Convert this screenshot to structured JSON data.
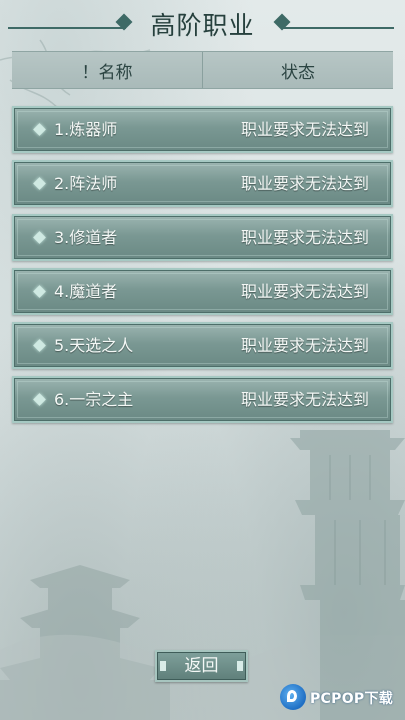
{
  "title": "高阶职业",
  "header": {
    "name_label": "！名称",
    "state_label": "状态"
  },
  "classes": [
    {
      "name": "1.炼器师",
      "status": "职业要求无法达到"
    },
    {
      "name": "2.阵法师",
      "status": "职业要求无法达到"
    },
    {
      "name": "3.修道者",
      "status": "职业要求无法达到"
    },
    {
      "name": "4.魔道者",
      "status": "职业要求无法达到"
    },
    {
      "name": "5.天选之人",
      "status": "职业要求无法达到"
    },
    {
      "name": "6.一宗之主",
      "status": "职业要求无法达到"
    }
  ],
  "back_label": "返回",
  "watermark": {
    "text": "PCPOP下载"
  },
  "colors": {
    "title": "#26403d",
    "row_fill": "#7a9893",
    "row_border": "#a6c9c3",
    "text_light": "#f4f8f6"
  }
}
